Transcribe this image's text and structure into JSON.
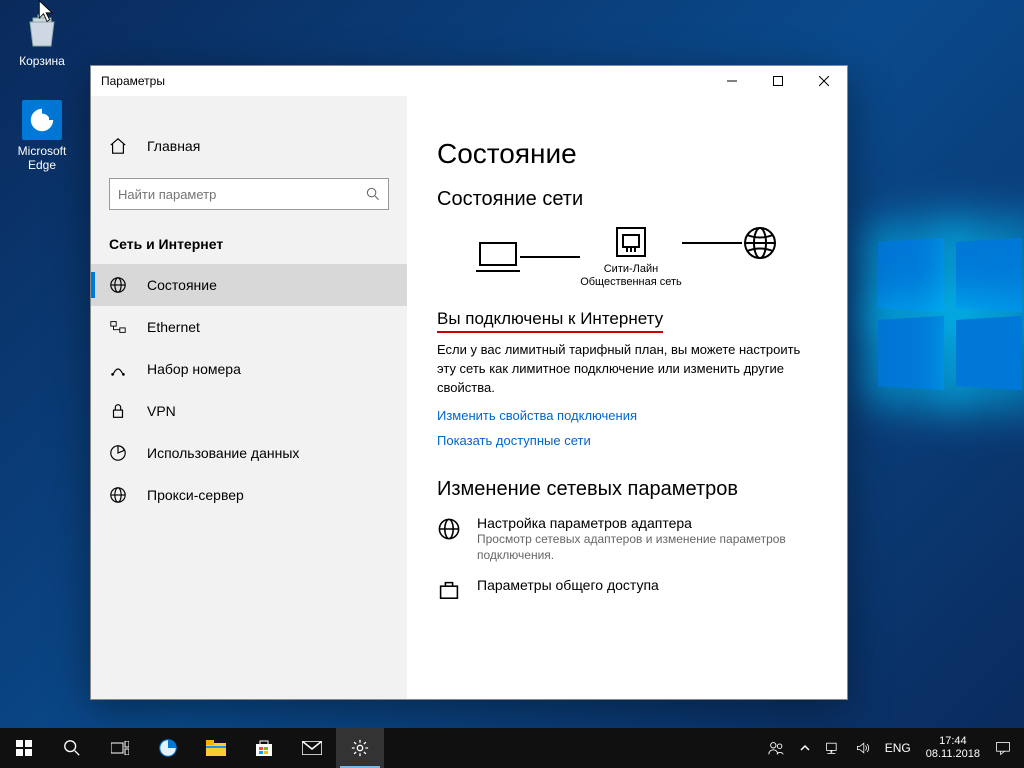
{
  "desktop": {
    "icons": [
      {
        "label": "Корзина"
      },
      {
        "label": "Microsoft Edge"
      }
    ]
  },
  "window": {
    "title": "Параметры",
    "sidebar": {
      "home": "Главная",
      "search_placeholder": "Найти параметр",
      "category": "Сеть и Интернет",
      "items": [
        {
          "label": "Состояние",
          "active": true
        },
        {
          "label": "Ethernet"
        },
        {
          "label": "Набор номера"
        },
        {
          "label": "VPN"
        },
        {
          "label": "Использование данных"
        },
        {
          "label": "Прокси-сервер"
        }
      ]
    },
    "content": {
      "page_title": "Состояние",
      "section_network": "Состояние сети",
      "diagram": {
        "network_name": "Сити-Лайн",
        "network_type": "Общественная сеть"
      },
      "connected_heading": "Вы подключены к Интернету",
      "connected_body": "Если у вас лимитный тарифный план, вы можете настроить эту сеть как лимитное подключение или изменить другие свойства.",
      "link_change_props": "Изменить свойства подключения",
      "link_show_networks": "Показать доступные сети",
      "section_change": "Изменение сетевых параметров",
      "adapter": {
        "title": "Настройка параметров адаптера",
        "sub": "Просмотр сетевых адаптеров и изменение параметров подключения."
      },
      "sharing": {
        "title": "Параметры общего доступа"
      }
    }
  },
  "taskbar": {
    "lang": "ENG",
    "time": "17:44",
    "date": "08.11.2018"
  }
}
